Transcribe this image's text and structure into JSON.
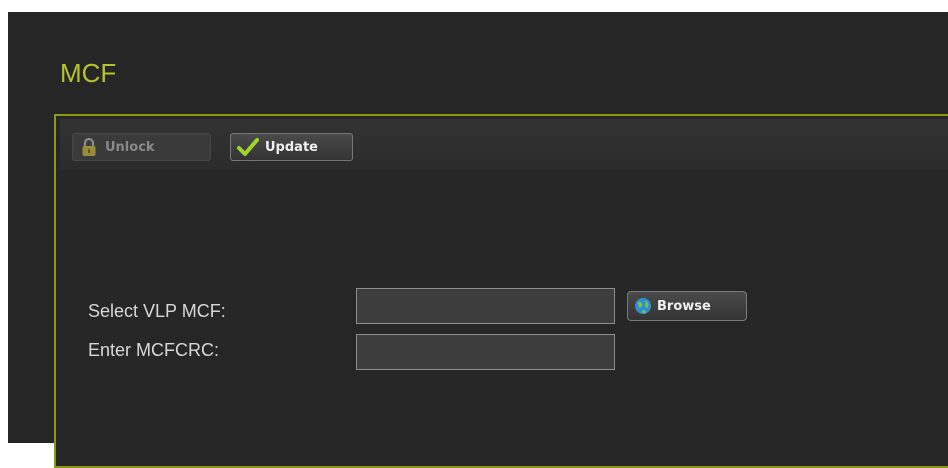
{
  "page": {
    "title": "MCF"
  },
  "toolbar": {
    "unlock_label": "Unlock",
    "update_label": "Update",
    "unlock_icon": "lock-icon",
    "update_icon": "checkmark-icon"
  },
  "form": {
    "vlp_label": "Select VLP MCF:",
    "vlp_value": "",
    "browse_label": "Browse",
    "browse_icon": "globe-icon",
    "crc_label": "Enter MCFCRC:",
    "crc_value": ""
  },
  "colors": {
    "accent": "#b5c232",
    "panel_border": "#8b9a12",
    "background": "#262626"
  }
}
